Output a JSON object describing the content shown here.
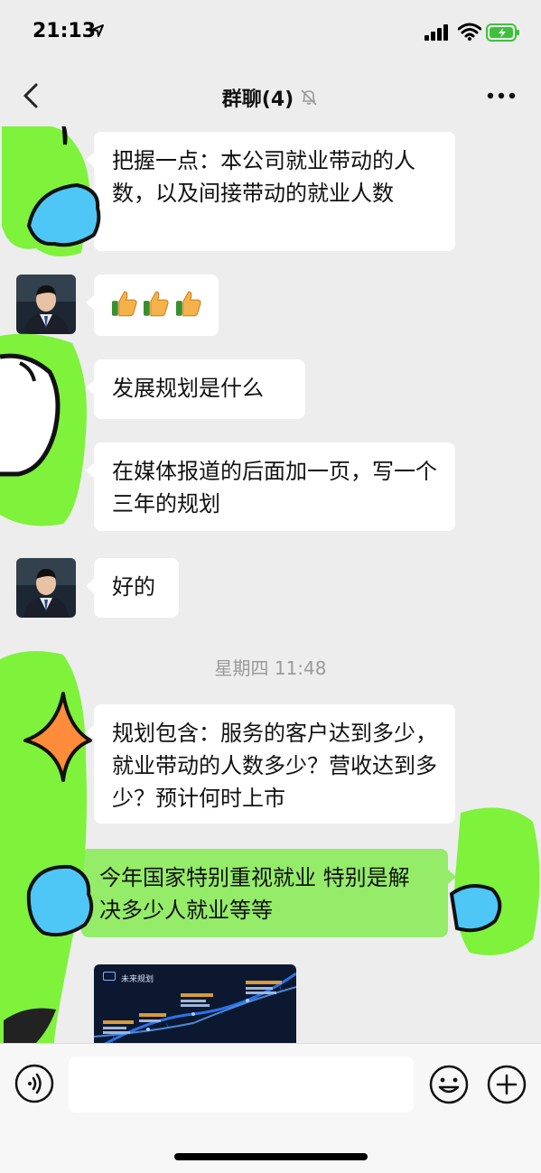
{
  "status": {
    "time": "21:13"
  },
  "nav": {
    "title": "群聊(4)"
  },
  "messages": [
    {
      "id": "m1",
      "text": "把握一点：本公司就业带动的人数，以及间接带动的就业人数"
    },
    {
      "id": "m2",
      "emoji": [
        "👍",
        "👍",
        "👍"
      ]
    },
    {
      "id": "m3",
      "text": "发展规划是什么"
    },
    {
      "id": "m4",
      "text": "在媒体报道的后面加一页，写一个三年的规划"
    },
    {
      "id": "m5",
      "text": "好的"
    },
    {
      "id": "m6",
      "text": "规划包含：服务的客户达到多少，就业带动的人数多少？营收达到多少？预计何时上市"
    },
    {
      "id": "m7",
      "text": "今年国家特别重视就业 特别是解决多少人就业等等"
    }
  ],
  "timestamp": "星期四 11:48",
  "image_message": {
    "caption": "未来规划"
  },
  "colors": {
    "background": "#ededed",
    "bubble_in": "#ffffff",
    "bubble_out": "#95ec69",
    "doodle_green": "#7ff23c",
    "doodle_blue": "#4fc7f6",
    "doodle_orange": "#ff8c3a"
  }
}
